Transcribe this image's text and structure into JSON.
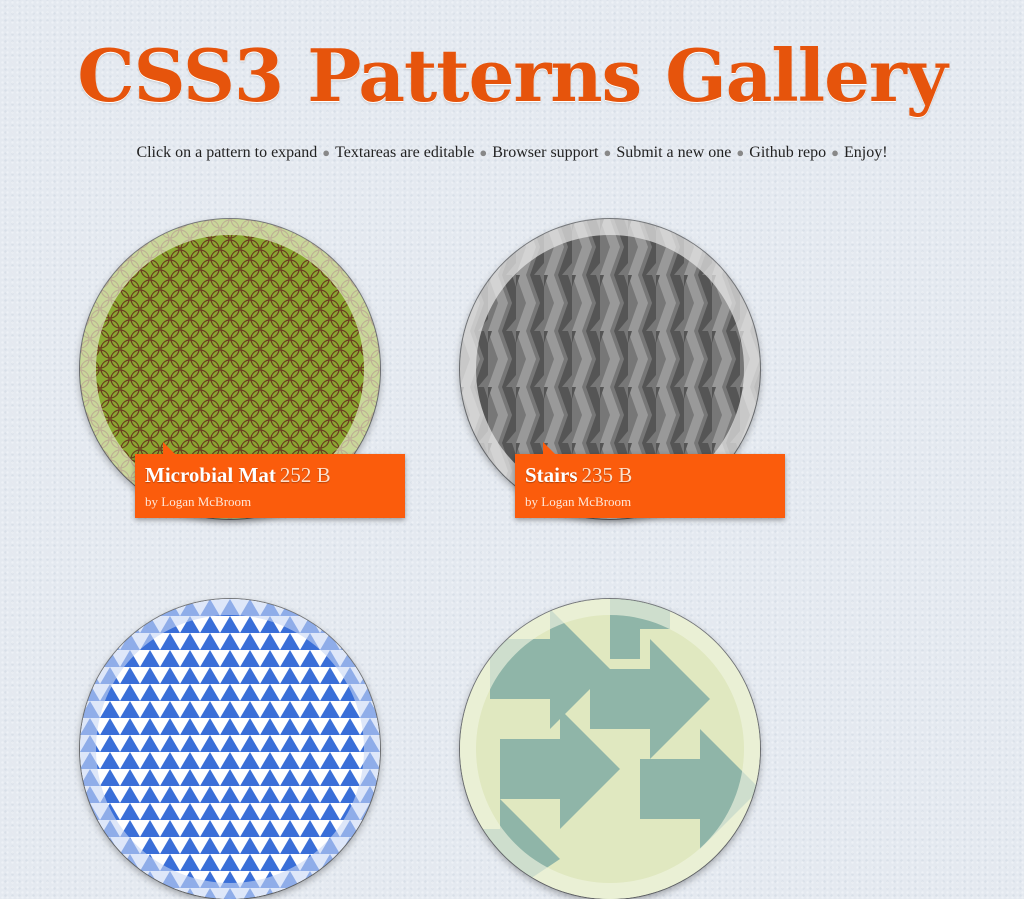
{
  "page": {
    "title": "CSS3 Patterns Gallery",
    "nav": [
      {
        "label": "Click on a pattern to expand",
        "link": false
      },
      {
        "label": "Textareas are editable",
        "link": false
      },
      {
        "label": "Browser support",
        "link": true
      },
      {
        "label": "Submit a new one",
        "link": true
      },
      {
        "label": "Github repo",
        "link": true
      },
      {
        "label": "Enjoy!",
        "link": false
      }
    ],
    "separator": "●"
  },
  "colors": {
    "accent": "#e6540c",
    "label_bg": "#fb5c0c",
    "background": "#e4e9f0"
  },
  "patterns": [
    {
      "name": "Microbial Mat",
      "size": "252 B",
      "author": "by Logan McBroom",
      "icon": "microbial-mat-pattern"
    },
    {
      "name": "Stairs",
      "size": "235 B",
      "author": "by Logan McBroom",
      "icon": "stairs-pattern"
    },
    {
      "name": "",
      "size": "",
      "author": "",
      "icon": "triangles-pattern"
    },
    {
      "name": "",
      "size": "",
      "author": "",
      "icon": "arrows-pattern"
    }
  ]
}
